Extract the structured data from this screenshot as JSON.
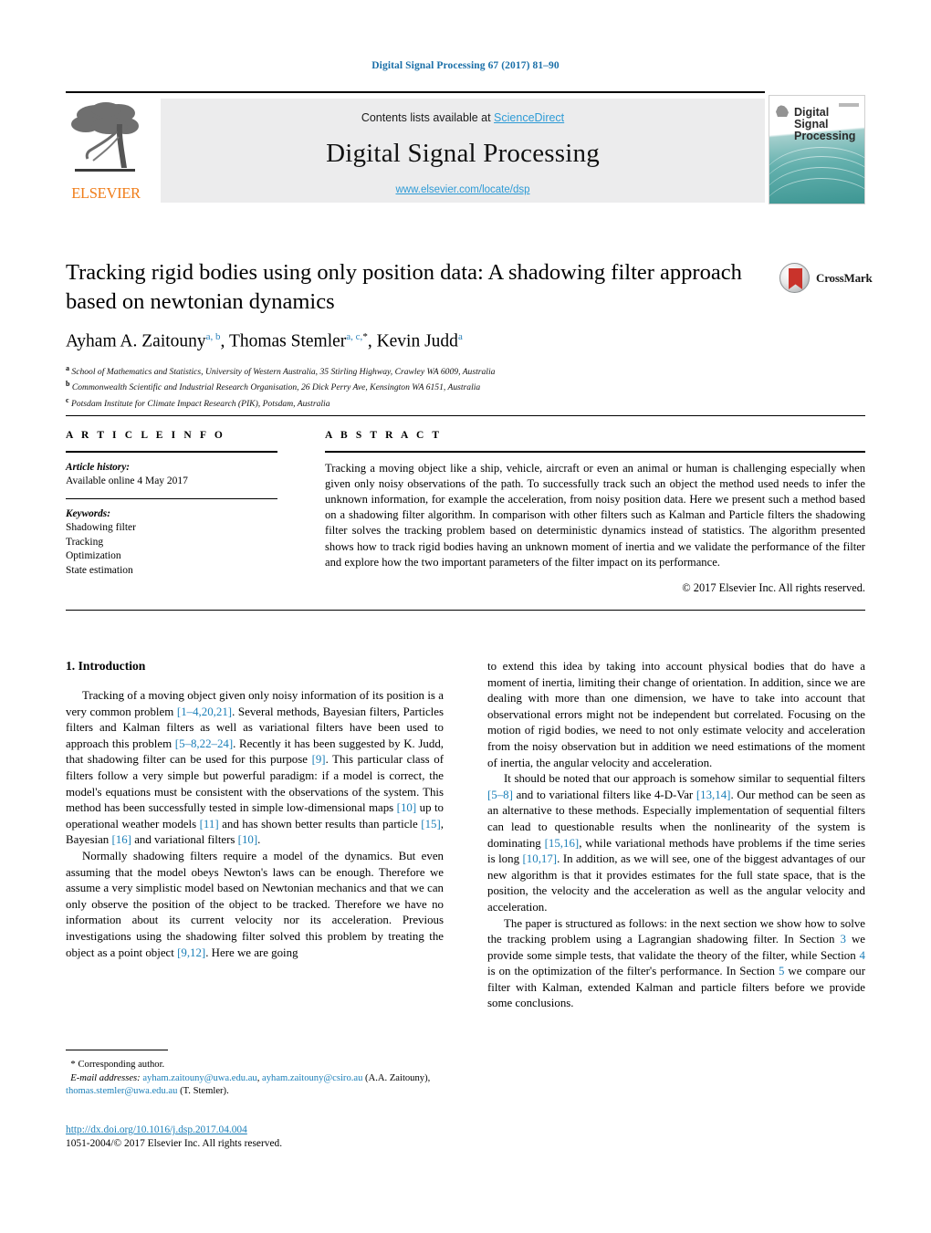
{
  "running_head": "Digital Signal Processing 67 (2017) 81–90",
  "masthead": {
    "contents_prefix": "Contents lists available at ",
    "sciencedirect": "ScienceDirect",
    "journal_title": "Digital Signal Processing",
    "journal_url": "www.elsevier.com/locate/dsp",
    "publisher_logo_text": "ELSEVIER",
    "cover_title_line1": "Digital",
    "cover_title_line2": "Signal",
    "cover_title_line3": "Processing",
    "accent_link_color": "#2e9bd6",
    "band_color": "#ececed",
    "cover_color": "#3d9693"
  },
  "article": {
    "title": "Tracking rigid bodies using only position data: A shadowing filter approach based on newtonian dynamics",
    "crossmark_label": "CrossMark",
    "authors_html": "Ayham A. Zaitouny<sup>a, b</sup>, Thomas Stemler<sup>a, c,</sup><sup class=\"star\">*</sup>, Kevin Judd<sup>a</sup>",
    "affiliations": [
      {
        "marker": "a",
        "text": "School of Mathematics and Statistics, University of Western Australia, 35 Stirling Highway, Crawley WA 6009, Australia"
      },
      {
        "marker": "b",
        "text": "Commonwealth Scientific and Industrial Research Organisation, 26 Dick Perry Ave, Kensington WA 6151, Australia"
      },
      {
        "marker": "c",
        "text": "Potsdam Institute for Climate Impact Research (PIK), Potsdam, Australia"
      }
    ]
  },
  "article_info": {
    "heading": "A R T I C L E   I N F O",
    "history_label": "Article history:",
    "history_value": "Available online 4 May 2017",
    "keywords_label": "Keywords:",
    "keywords": [
      "Shadowing filter",
      "Tracking",
      "Optimization",
      "State estimation"
    ]
  },
  "abstract": {
    "heading": "A B S T R A C T",
    "text": "Tracking a moving object like a ship, vehicle, aircraft or even an animal or human is challenging especially when given only noisy observations of the path. To successfully track such an object the method used needs to infer the unknown information, for example the acceleration, from noisy position data. Here we present such a method based on a shadowing filter algorithm. In comparison with other filters such as Kalman and Particle filters the shadowing filter solves the tracking problem based on deterministic dynamics instead of statistics. The algorithm presented shows how to track rigid bodies having an unknown moment of inertia and we validate the performance of the filter and explore how the two important parameters of the filter impact on its performance.",
    "copyright": "© 2017 Elsevier Inc. All rights reserved."
  },
  "introduction": {
    "heading": "1. Introduction",
    "left_paragraphs_html": [
      "Tracking of a moving object given only noisy information of its position is a very common problem <span class=\"ref\">[1–4,20,21]</span>. Several methods, Bayesian filters, Particles filters and Kalman filters as well as variational filters have been used to approach this problem <span class=\"ref\">[5–8,22–24]</span>. Recently it has been suggested by K. Judd, that shadowing filter can be used for this purpose <span class=\"ref\">[9]</span>. This particular class of filters follow a very simple but powerful paradigm: if a model is correct, the model's equations must be consistent with the observations of the system. This method has been successfully tested in simple low-dimensional maps <span class=\"ref\">[10]</span> up to operational weather models <span class=\"ref\">[11]</span> and has shown better results than particle <span class=\"ref\">[15]</span>, Bayesian <span class=\"ref\">[16]</span> and variational filters <span class=\"ref\">[10]</span>.",
      "Normally shadowing filters require a model of the dynamics. But even assuming that the model obeys Newton's laws can be enough. Therefore we assume a very simplistic model based on Newtonian mechanics and that we can only observe the position of the object to be tracked. Therefore we have no information about its current velocity nor its acceleration. Previous investigations using the shadowing filter solved this problem by treating the object as a point object <span class=\"ref\">[9,12]</span>. Here we are going"
    ],
    "right_paragraphs_html": [
      "to extend this idea by taking into account physical bodies that do have a moment of inertia, limiting their change of orientation. In addition, since we are dealing with more than one dimension, we have to take into account that observational errors might not be independent but correlated. Focusing on the motion of rigid bodies, we need to not only estimate velocity and acceleration from the noisy observation but in addition we need estimations of the moment of inertia, the angular velocity and acceleration.",
      "It should be noted that our approach is somehow similar to sequential filters <span class=\"ref\">[5–8]</span> and to variational filters like 4-D-Var <span class=\"ref\">[13,14]</span>. Our method can be seen as an alternative to these methods. Especially implementation of sequential filters can lead to questionable results when the nonlinearity of the system is dominating <span class=\"ref\">[15,16]</span>, while variational methods have problems if the time series is long <span class=\"ref\">[10,17]</span>. In addition, as we will see, one of the biggest advantages of our new algorithm is that it provides estimates for the full state space, that is the position, the velocity and the acceleration as well as the angular velocity and acceleration.",
      "The paper is structured as follows: in the next section we show how to solve the tracking problem using a Lagrangian shadowing filter. In Section <span class=\"ref\">3</span> we provide some simple tests, that validate the theory of the filter, while Section <span class=\"ref\">4</span> is on the optimization of the filter's performance. In Section <span class=\"ref\">5</span> we compare our filter with Kalman, extended Kalman and particle filters before we provide some conclusions."
    ]
  },
  "footnote": {
    "star": "*",
    "corresponding": "Corresponding author.",
    "email_label": "E-mail addresses:",
    "emails_html": "<span class=\"link\">ayham.zaitouny@uwa.edu.au</span>, <span class=\"link\">ayham.zaitouny@csiro.au</span> (A.A. Zaitouny), <span class=\"link\">thomas.stemler@uwa.edu.au</span> (T. Stemler).",
    "doi": "http://dx.doi.org/10.1016/j.dsp.2017.04.004",
    "issn": "1051-2004/© 2017 Elsevier Inc. All rights reserved."
  }
}
